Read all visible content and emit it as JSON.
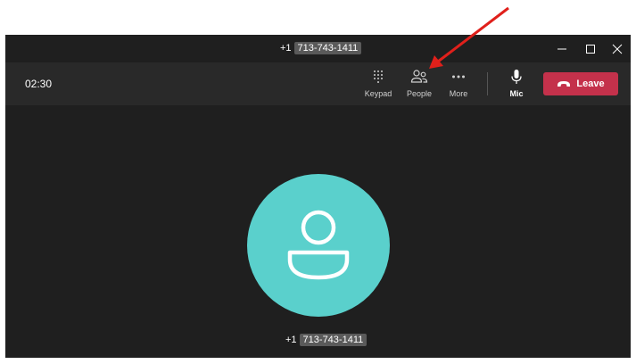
{
  "window": {
    "title_prefix": "+1",
    "title_number": "713-743-1411",
    "controls": {
      "minimize_icon": "minimize-icon",
      "maximize_icon": "maximize-icon",
      "close_icon": "close-icon"
    }
  },
  "toolbar": {
    "timer": "02:30",
    "buttons": [
      {
        "label": "Keypad",
        "icon": "keypad-icon"
      },
      {
        "label": "People",
        "icon": "people-icon"
      },
      {
        "label": "More",
        "icon": "more-icon"
      },
      {
        "label": "Mic",
        "icon": "mic-icon"
      }
    ],
    "leave_label": "Leave"
  },
  "stage": {
    "caller_prefix": "+1",
    "caller_number": "713-743-1411"
  },
  "colors": {
    "window_bg": "#1f1f1f",
    "toolbar_bg": "#292929",
    "avatar": "#5ad0cc",
    "leave": "#c4314b",
    "annotation_arrow": "#e0201b"
  }
}
